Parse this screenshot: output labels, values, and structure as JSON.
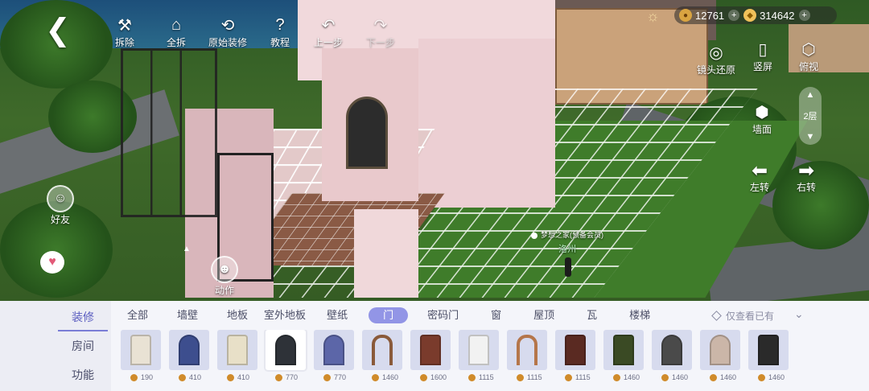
{
  "hud": {
    "back_icon": "back-chevron-icon",
    "toolbar": [
      {
        "id": "demolish",
        "label": "拆除",
        "icon": "hammer-icon"
      },
      {
        "id": "demolish_all",
        "label": "全拆",
        "icon": "house-demolish-icon"
      },
      {
        "id": "original_decor",
        "label": "原始装修",
        "icon": "house-restore-icon"
      },
      {
        "id": "tutorial",
        "label": "教程",
        "icon": "question-book-icon"
      },
      {
        "id": "undo",
        "label": "上一步",
        "icon": "undo-arrow-icon"
      },
      {
        "id": "redo",
        "label": "下一步",
        "icon": "redo-arrow-icon"
      }
    ],
    "weather_icon": "sun-cloud-icon",
    "currency": {
      "gold": "12761",
      "star": "314642"
    },
    "view": {
      "reset_camera": "镜头还原",
      "portrait": "竖屏",
      "top_view": "俯视",
      "wall": "墙面"
    },
    "floor": {
      "label": "2层"
    },
    "rotate_left": "左转",
    "rotate_right": "右转",
    "friends": "好友",
    "action": "动作"
  },
  "house_label": {
    "name": "梦想之家(预备会员)",
    "location": "洛州"
  },
  "panel": {
    "left_menu": [
      {
        "label": "装修",
        "active": true
      },
      {
        "label": "房间",
        "active": false
      },
      {
        "label": "功能",
        "active": false
      }
    ],
    "tabs": [
      {
        "label": "全部",
        "active": false
      },
      {
        "label": "墙壁",
        "active": false
      },
      {
        "label": "地板",
        "active": false
      },
      {
        "label": "室外地板",
        "active": false
      },
      {
        "label": "壁纸",
        "active": false
      },
      {
        "label": "门",
        "active": true
      },
      {
        "label": "密码门",
        "active": false
      },
      {
        "label": "窗",
        "active": false
      },
      {
        "label": "屋顶",
        "active": false
      },
      {
        "label": "瓦",
        "active": false
      },
      {
        "label": "楼梯",
        "active": false
      }
    ],
    "filter_label": "仅查看已有",
    "items": [
      {
        "price": "190",
        "color": "#e9e2d4",
        "shape": "rect"
      },
      {
        "price": "410",
        "color": "#3d4e8e",
        "shape": "arch"
      },
      {
        "price": "410",
        "color": "#e8e0c8",
        "shape": "rect"
      },
      {
        "price": "770",
        "color": "#2e3238",
        "shape": "arch"
      },
      {
        "price": "770",
        "color": "#5c66a8",
        "shape": "arch"
      },
      {
        "price": "1460",
        "color": "#8a5a3a",
        "shape": "frame"
      },
      {
        "price": "1600",
        "color": "#7a3b2c",
        "shape": "rect"
      },
      {
        "price": "1115",
        "color": "#f2f2f2",
        "shape": "rect"
      },
      {
        "price": "1115",
        "color": "#b5764a",
        "shape": "frame"
      },
      {
        "price": "1115",
        "color": "#5a2a22",
        "shape": "rect"
      },
      {
        "price": "1460",
        "color": "#3a4a24",
        "shape": "rect"
      },
      {
        "price": "1460",
        "color": "#4a4a4a",
        "shape": "arch"
      },
      {
        "price": "1460",
        "color": "#cbb6a8",
        "shape": "arch"
      },
      {
        "price": "1460",
        "color": "#2a2a2a",
        "shape": "rect"
      }
    ]
  }
}
